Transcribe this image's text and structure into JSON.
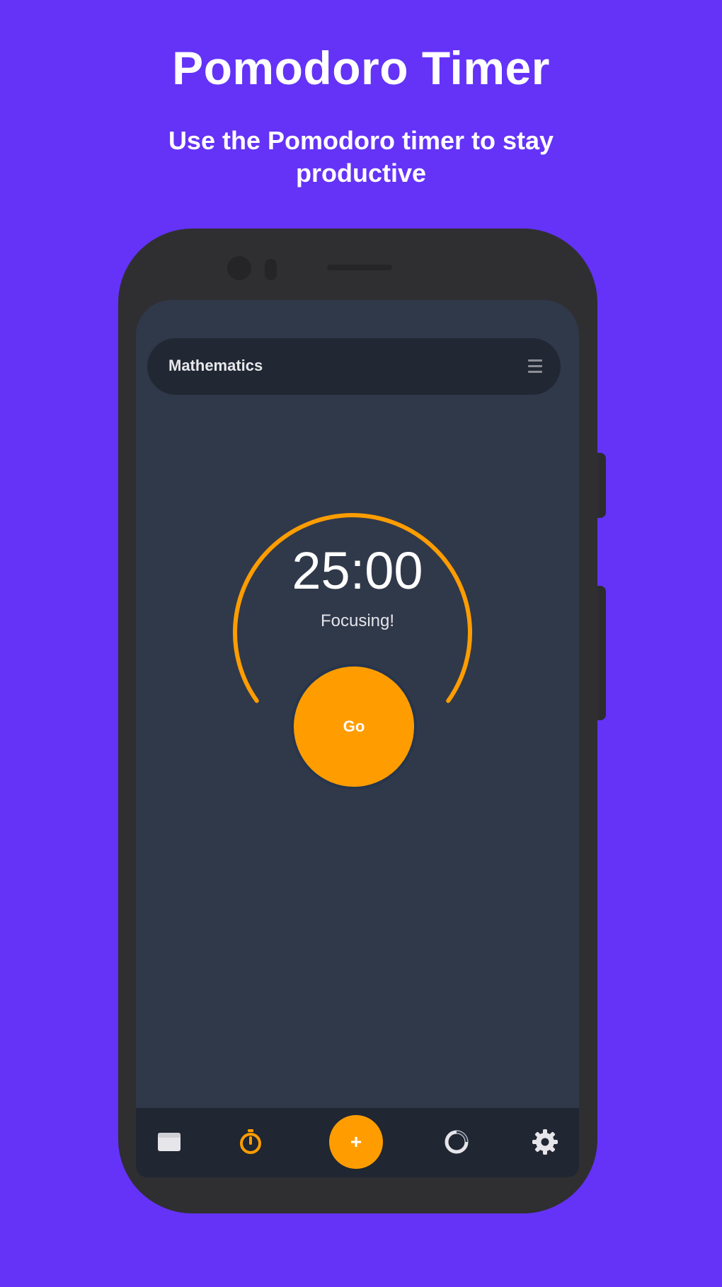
{
  "header": {
    "title": "Pomodoro Timer",
    "subtitle": "Use the Pomodoro timer to stay productive"
  },
  "app": {
    "subject": "Mathematics",
    "timer": {
      "time": "25:00",
      "status": "Focusing!",
      "go_label": "Go"
    },
    "nav": {
      "add_label": "+",
      "active_item": "timer"
    }
  },
  "colors": {
    "background": "#6433f7",
    "screen": "#30394a",
    "accent": "#ff9d00",
    "bar": "#212834"
  },
  "icons": {
    "list": "list-icon",
    "nav": [
      "calendar-icon",
      "timer-icon",
      "add-icon",
      "chart-icon",
      "gear-icon"
    ]
  }
}
